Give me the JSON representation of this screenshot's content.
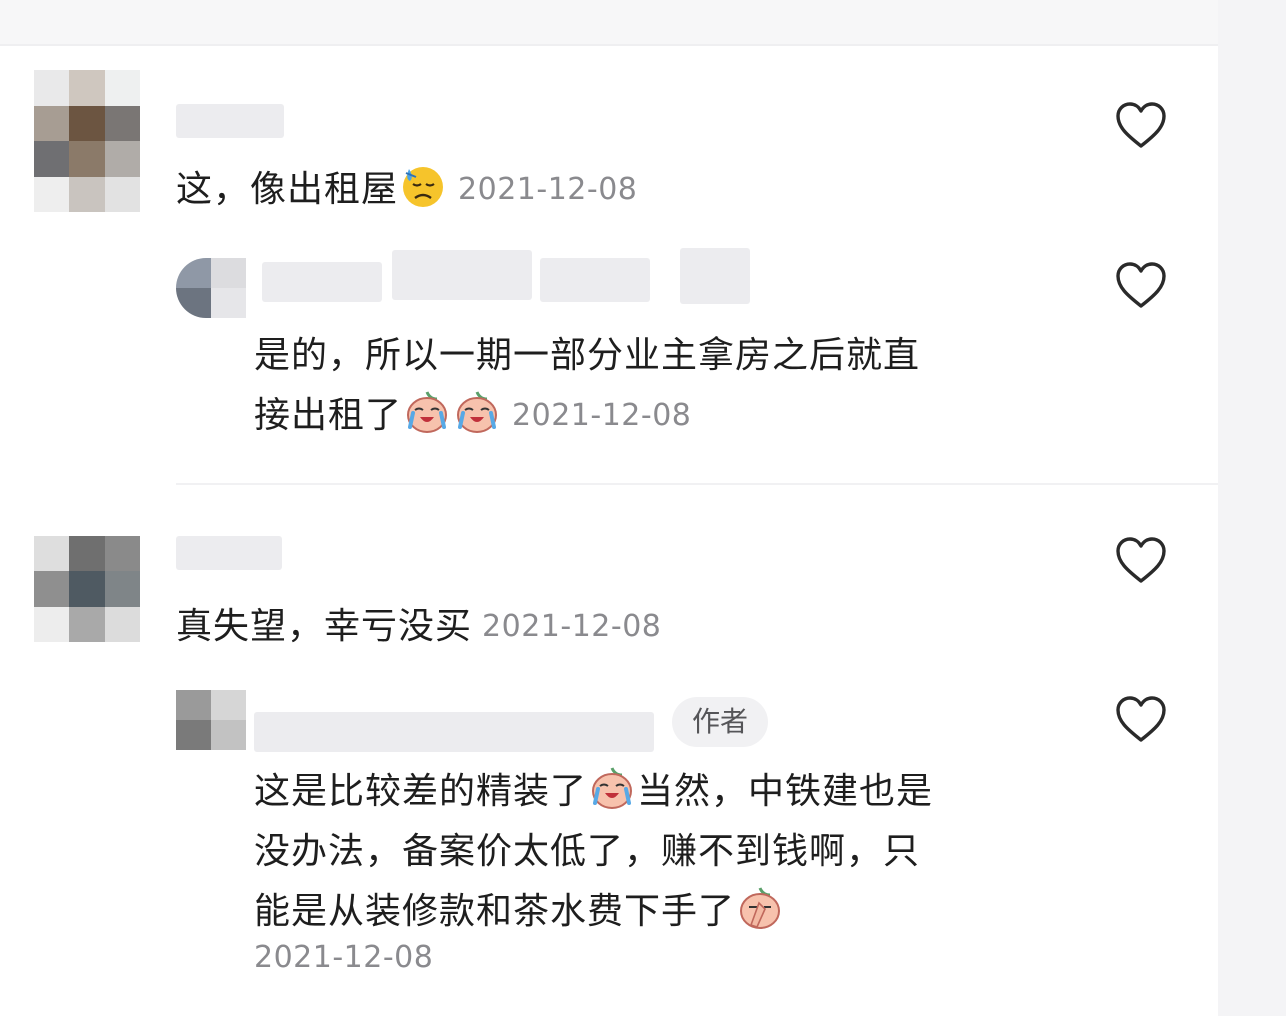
{
  "comments": [
    {
      "text": "这，像出租屋",
      "emoji": "sweat-sad-emoji",
      "date": "2021-12-08",
      "replies": [
        {
          "text_line1": "是的，所以一期一部分业主拿房之后就直",
          "text_line2": "接出租了",
          "emoji": "crying-peach-emoji",
          "date": "2021-12-08"
        }
      ]
    },
    {
      "text": "真失望，幸亏没买",
      "date": "2021-12-08",
      "replies": [
        {
          "author_badge": "作者",
          "text_line1_before": "这是比较差的精装了",
          "text_line1_after": "当然，中铁建也是",
          "text_line2": "没办法，备案价太低了，赚不到钱啊，只",
          "text_line3": "能是从装修款和茶水费下手了",
          "emoji_1": "crying-peach-emoji",
          "emoji_2": "facepalm-peach-emoji",
          "date": "2021-12-08"
        }
      ]
    }
  ],
  "icons": {
    "like": "heart-outline-icon"
  },
  "colors": {
    "text": "#1e1e1e",
    "timestamp": "#8a8a8e",
    "badge_bg": "#f1f1f3"
  }
}
